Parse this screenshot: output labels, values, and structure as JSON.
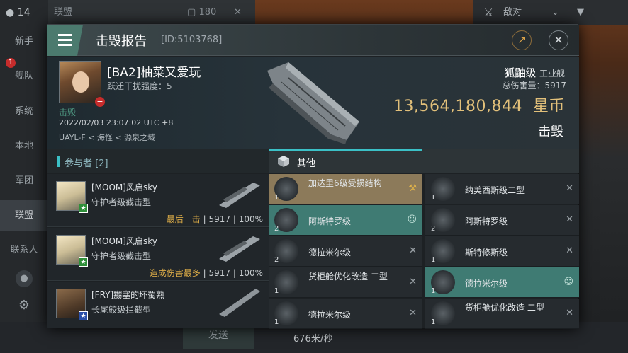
{
  "background": {
    "status_count": "14",
    "chat_channel": "联盟",
    "chat_count": "180",
    "filter_label": "敌对",
    "nav": [
      "新手",
      "舰队",
      "系统",
      "本地",
      "军团",
      "联盟",
      "联系人"
    ],
    "nav_badge": "1",
    "send_label": "发送",
    "speed": "676米/秒"
  },
  "dialog": {
    "title": "击毁报告",
    "id_label": "[ID:5103768]",
    "victim": {
      "name": "[BA2]柚菜又爱玩",
      "warp_jam": "跃迁干扰强度：5",
      "role": "击毁",
      "time": "2022/02/03 23:07:02 UTC +8",
      "location": "UAYL-F < 海怪 < 源泉之域",
      "ship_class": "狐鼬级",
      "ship_type": "工业舰",
      "total_damage": "总伤害量：5917",
      "isk_value": "13,564,180,844",
      "isk_unit": "星币",
      "status": "击毁"
    },
    "participants_title": "参与者 [2]",
    "participants": [
      {
        "name": "[MOOM]风启sky",
        "ship": "守护者级截击型",
        "tag": "最后一击",
        "damage": "5917",
        "percent": "100%"
      },
      {
        "name": "[MOOM]风启sky",
        "ship": "守护者级截击型",
        "tag": "造成伤害最多",
        "damage": "5917",
        "percent": "100%"
      },
      {
        "name": "[FRY]嬲塞的坏蜀熟",
        "ship": "长尾鲛级拦截型",
        "tag": "",
        "damage": "",
        "percent": ""
      }
    ],
    "items_title": "其他",
    "items": [
      {
        "name": "加达里6级受损结构",
        "qty": "1",
        "style": "hl",
        "mark": "wrench-icon"
      },
      {
        "name": "纳美西斯级二型",
        "qty": "1",
        "style": "",
        "mark": "close-icon"
      },
      {
        "name": "阿斯特罗级",
        "qty": "2",
        "style": "tl",
        "mark": "person-icon"
      },
      {
        "name": "阿斯特罗级",
        "qty": "2",
        "style": "",
        "mark": "close-icon"
      },
      {
        "name": "德拉米尔级",
        "qty": "2",
        "style": "",
        "mark": "close-icon"
      },
      {
        "name": "斯特修斯级",
        "qty": "1",
        "style": "",
        "mark": "close-icon"
      },
      {
        "name": "货柜舱优化改造 二型",
        "qty": "1",
        "style": "",
        "mark": "close-icon"
      },
      {
        "name": "德拉米尔级",
        "qty": "1",
        "style": "tl",
        "mark": "person-icon"
      },
      {
        "name": "德拉米尔级",
        "qty": "1",
        "style": "",
        "mark": "close-icon"
      },
      {
        "name": "货柜舱优化改造 二型",
        "qty": "1",
        "style": "",
        "mark": "close-icon"
      }
    ]
  }
}
